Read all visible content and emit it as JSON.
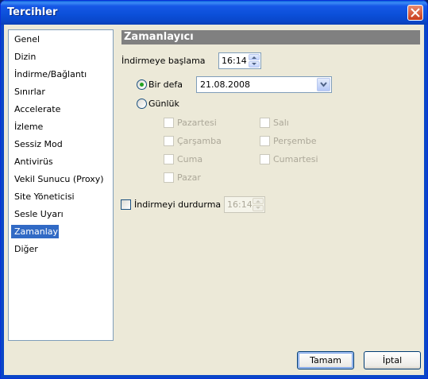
{
  "window": {
    "title": "Tercihler"
  },
  "nav": {
    "items": [
      {
        "label": "Genel"
      },
      {
        "label": "Dizin"
      },
      {
        "label": "İndirme/Bağlantı"
      },
      {
        "label": "Sınırlar"
      },
      {
        "label": "Accelerate"
      },
      {
        "label": "İzleme"
      },
      {
        "label": "Sessiz Mod"
      },
      {
        "label": "Antivirüs"
      },
      {
        "label": "Vekil Sunucu (Proxy)"
      },
      {
        "label": "Site Yöneticisi"
      },
      {
        "label": "Sesle Uyarı"
      },
      {
        "label": "Zamanlayıcı"
      },
      {
        "label": "Diğer"
      }
    ],
    "selected": "Zamanlayıcı"
  },
  "scheduler": {
    "header": "Zamanlayıcı",
    "start_label": "İndirmeye başlama",
    "start_time": "16:14",
    "once_label": "Bir defa",
    "once_selected": true,
    "date": "21.08.2008",
    "daily_label": "Günlük",
    "days": {
      "monday": "Pazartesi",
      "tuesday": "Salı",
      "wednesday": "Çarşamba",
      "thursday": "Perşembe",
      "friday": "Cuma",
      "saturday": "Cumartesi",
      "sunday": "Pazar"
    },
    "stop_label": "İndirmeyi durdurma",
    "stop_checked": false,
    "stop_time": "16:14"
  },
  "buttons": {
    "ok": "Tamam",
    "cancel": "İptal"
  },
  "colors": {
    "selection": "#316ac5",
    "titlebar": "#0a46c8",
    "radio_dot": "#21a121",
    "header_bg": "#808080"
  },
  "icons": {
    "close": "close-x-icon",
    "spin_up": "arrow-up-icon",
    "spin_down": "arrow-down-icon",
    "dropdown": "chevron-down-icon"
  }
}
